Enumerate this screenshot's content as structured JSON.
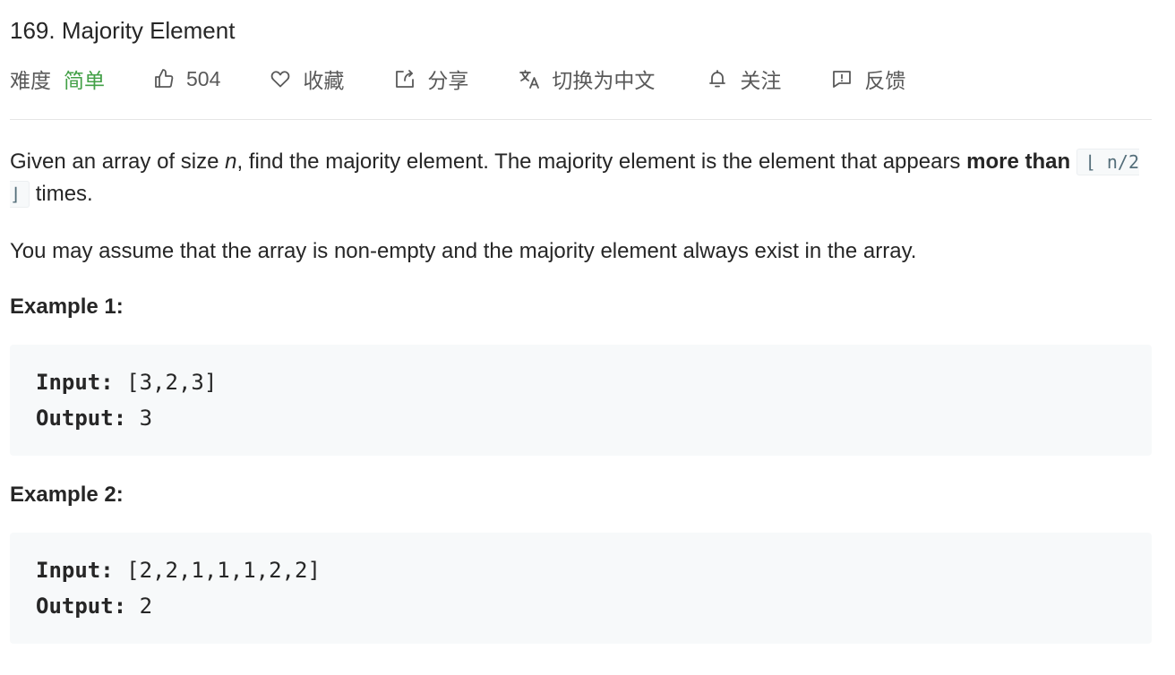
{
  "problem": {
    "title": "169. Majority Element"
  },
  "meta": {
    "difficulty_label": "难度",
    "difficulty_value": "简单",
    "likes": "504",
    "favorite_label": "收藏",
    "share_label": "分享",
    "translate_label": "切换为中文",
    "follow_label": "关注",
    "feedback_label": "反馈",
    "difficulty_color": "#43a047"
  },
  "description": {
    "p1_part1": "Given an array of size ",
    "p1_n": "n",
    "p1_part2": ", find the majority element. The majority element is the element that appears ",
    "p1_bold": "more than",
    "p1_code": "⌊ n/2 ⌋",
    "p1_part3": " times.",
    "p2": "You may assume that the array is non-empty and the majority element always exist in the array."
  },
  "examples": [
    {
      "title": "Example 1:",
      "input_label": "Input:",
      "input_value": " [3,2,3]",
      "output_label": "Output:",
      "output_value": " 3"
    },
    {
      "title": "Example 2:",
      "input_label": "Input:",
      "input_value": " [2,2,1,1,1,2,2]",
      "output_label": "Output:",
      "output_value": " 2"
    }
  ]
}
